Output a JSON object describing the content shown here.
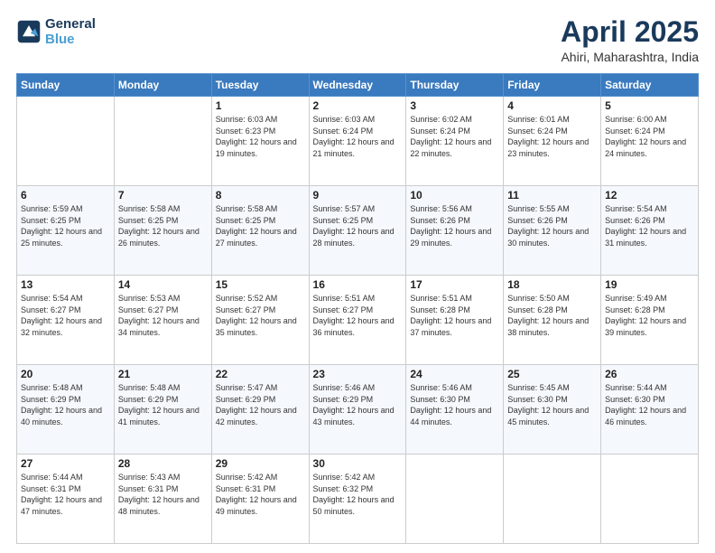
{
  "header": {
    "logo_line1": "General",
    "logo_line2": "Blue",
    "title": "April 2025",
    "subtitle": "Ahiri, Maharashtra, India"
  },
  "days_of_week": [
    "Sunday",
    "Monday",
    "Tuesday",
    "Wednesday",
    "Thursday",
    "Friday",
    "Saturday"
  ],
  "weeks": [
    [
      {
        "day": "",
        "info": ""
      },
      {
        "day": "",
        "info": ""
      },
      {
        "day": "1",
        "info": "Sunrise: 6:03 AM\nSunset: 6:23 PM\nDaylight: 12 hours\nand 19 minutes."
      },
      {
        "day": "2",
        "info": "Sunrise: 6:03 AM\nSunset: 6:24 PM\nDaylight: 12 hours\nand 21 minutes."
      },
      {
        "day": "3",
        "info": "Sunrise: 6:02 AM\nSunset: 6:24 PM\nDaylight: 12 hours\nand 22 minutes."
      },
      {
        "day": "4",
        "info": "Sunrise: 6:01 AM\nSunset: 6:24 PM\nDaylight: 12 hours\nand 23 minutes."
      },
      {
        "day": "5",
        "info": "Sunrise: 6:00 AM\nSunset: 6:24 PM\nDaylight: 12 hours\nand 24 minutes."
      }
    ],
    [
      {
        "day": "6",
        "info": "Sunrise: 5:59 AM\nSunset: 6:25 PM\nDaylight: 12 hours\nand 25 minutes."
      },
      {
        "day": "7",
        "info": "Sunrise: 5:58 AM\nSunset: 6:25 PM\nDaylight: 12 hours\nand 26 minutes."
      },
      {
        "day": "8",
        "info": "Sunrise: 5:58 AM\nSunset: 6:25 PM\nDaylight: 12 hours\nand 27 minutes."
      },
      {
        "day": "9",
        "info": "Sunrise: 5:57 AM\nSunset: 6:25 PM\nDaylight: 12 hours\nand 28 minutes."
      },
      {
        "day": "10",
        "info": "Sunrise: 5:56 AM\nSunset: 6:26 PM\nDaylight: 12 hours\nand 29 minutes."
      },
      {
        "day": "11",
        "info": "Sunrise: 5:55 AM\nSunset: 6:26 PM\nDaylight: 12 hours\nand 30 minutes."
      },
      {
        "day": "12",
        "info": "Sunrise: 5:54 AM\nSunset: 6:26 PM\nDaylight: 12 hours\nand 31 minutes."
      }
    ],
    [
      {
        "day": "13",
        "info": "Sunrise: 5:54 AM\nSunset: 6:27 PM\nDaylight: 12 hours\nand 32 minutes."
      },
      {
        "day": "14",
        "info": "Sunrise: 5:53 AM\nSunset: 6:27 PM\nDaylight: 12 hours\nand 34 minutes."
      },
      {
        "day": "15",
        "info": "Sunrise: 5:52 AM\nSunset: 6:27 PM\nDaylight: 12 hours\nand 35 minutes."
      },
      {
        "day": "16",
        "info": "Sunrise: 5:51 AM\nSunset: 6:27 PM\nDaylight: 12 hours\nand 36 minutes."
      },
      {
        "day": "17",
        "info": "Sunrise: 5:51 AM\nSunset: 6:28 PM\nDaylight: 12 hours\nand 37 minutes."
      },
      {
        "day": "18",
        "info": "Sunrise: 5:50 AM\nSunset: 6:28 PM\nDaylight: 12 hours\nand 38 minutes."
      },
      {
        "day": "19",
        "info": "Sunrise: 5:49 AM\nSunset: 6:28 PM\nDaylight: 12 hours\nand 39 minutes."
      }
    ],
    [
      {
        "day": "20",
        "info": "Sunrise: 5:48 AM\nSunset: 6:29 PM\nDaylight: 12 hours\nand 40 minutes."
      },
      {
        "day": "21",
        "info": "Sunrise: 5:48 AM\nSunset: 6:29 PM\nDaylight: 12 hours\nand 41 minutes."
      },
      {
        "day": "22",
        "info": "Sunrise: 5:47 AM\nSunset: 6:29 PM\nDaylight: 12 hours\nand 42 minutes."
      },
      {
        "day": "23",
        "info": "Sunrise: 5:46 AM\nSunset: 6:29 PM\nDaylight: 12 hours\nand 43 minutes."
      },
      {
        "day": "24",
        "info": "Sunrise: 5:46 AM\nSunset: 6:30 PM\nDaylight: 12 hours\nand 44 minutes."
      },
      {
        "day": "25",
        "info": "Sunrise: 5:45 AM\nSunset: 6:30 PM\nDaylight: 12 hours\nand 45 minutes."
      },
      {
        "day": "26",
        "info": "Sunrise: 5:44 AM\nSunset: 6:30 PM\nDaylight: 12 hours\nand 46 minutes."
      }
    ],
    [
      {
        "day": "27",
        "info": "Sunrise: 5:44 AM\nSunset: 6:31 PM\nDaylight: 12 hours\nand 47 minutes."
      },
      {
        "day": "28",
        "info": "Sunrise: 5:43 AM\nSunset: 6:31 PM\nDaylight: 12 hours\nand 48 minutes."
      },
      {
        "day": "29",
        "info": "Sunrise: 5:42 AM\nSunset: 6:31 PM\nDaylight: 12 hours\nand 49 minutes."
      },
      {
        "day": "30",
        "info": "Sunrise: 5:42 AM\nSunset: 6:32 PM\nDaylight: 12 hours\nand 50 minutes."
      },
      {
        "day": "",
        "info": ""
      },
      {
        "day": "",
        "info": ""
      },
      {
        "day": "",
        "info": ""
      }
    ]
  ]
}
